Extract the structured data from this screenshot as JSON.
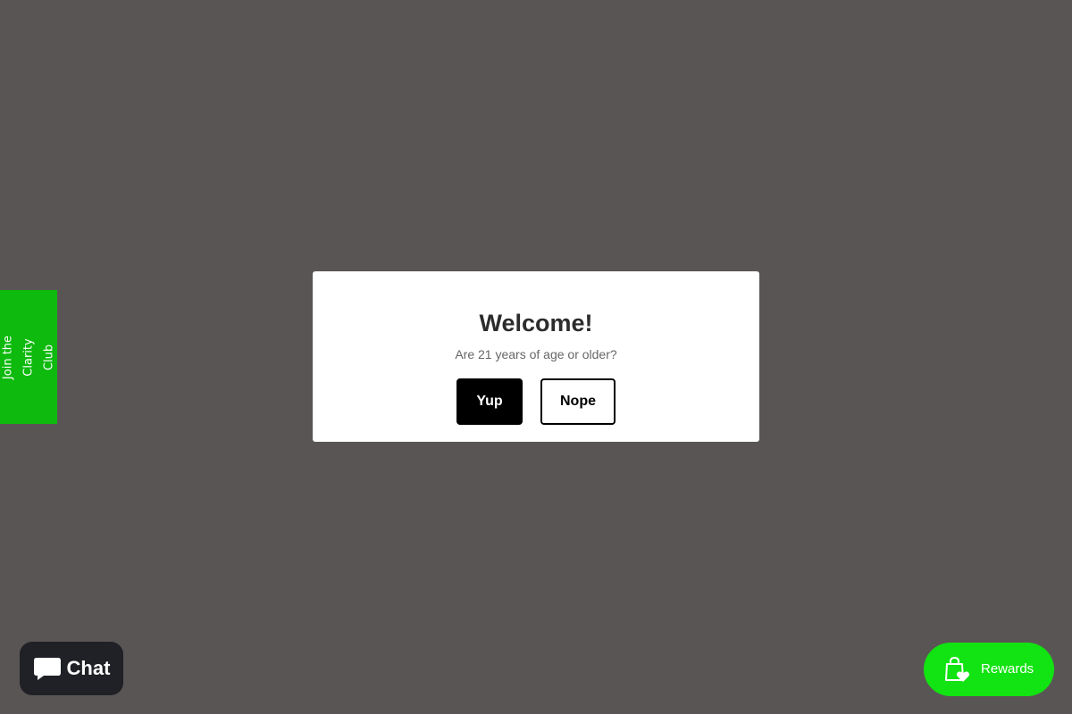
{
  "age_gate": {
    "title": "Welcome!",
    "question": "Are 21 years of age or older?",
    "yes_label": "Yup",
    "no_label": "Nope"
  },
  "side_tab": {
    "label": "Join the Clarity Club"
  },
  "chat": {
    "label": "Chat",
    "icon": "chat-bubble-icon"
  },
  "rewards": {
    "label": "Rewards",
    "icon": "shopping-bag-heart-icon"
  },
  "colors": {
    "overlay": "#5a5555",
    "side_tab": "#0dba0d",
    "rewards": "#12e312",
    "chat": "#1f2126",
    "primary_button": "#000000"
  }
}
